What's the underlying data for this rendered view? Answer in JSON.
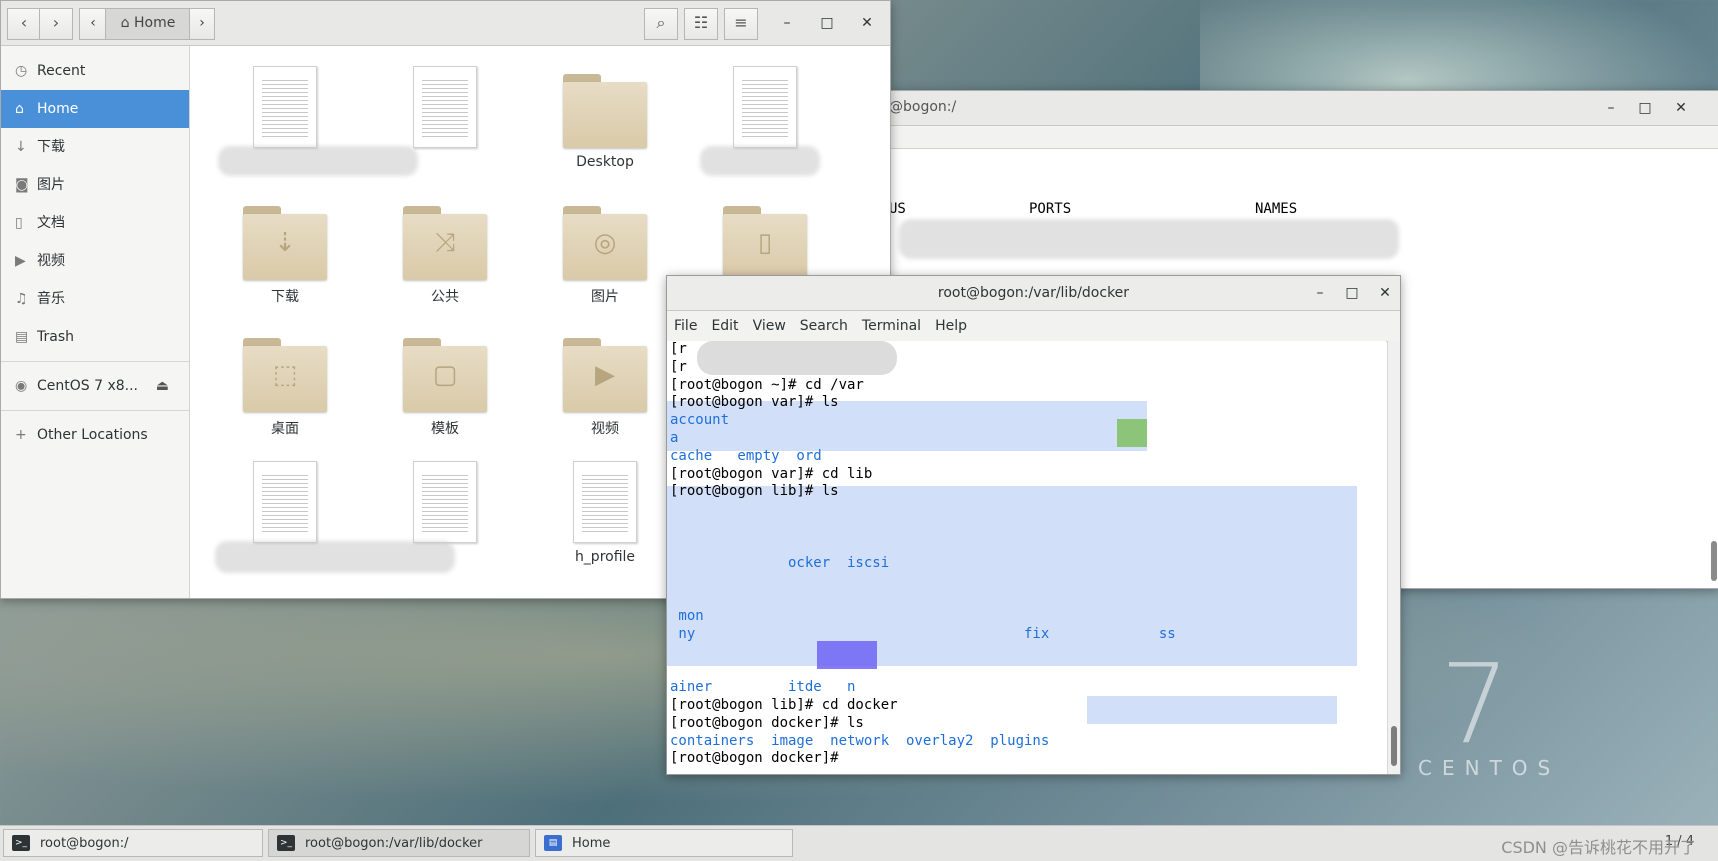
{
  "files_window": {
    "path_label": "Home",
    "sidebar": [
      {
        "icon": "clock-icon",
        "glyph": "◷",
        "label": "Recent"
      },
      {
        "icon": "home-icon",
        "glyph": "⌂",
        "label": "Home",
        "selected": true
      },
      {
        "icon": "download-icon",
        "glyph": "↓",
        "label": "下载"
      },
      {
        "icon": "camera-icon",
        "glyph": "◙",
        "label": "图片"
      },
      {
        "icon": "document-icon",
        "glyph": "▯",
        "label": "文档"
      },
      {
        "icon": "video-icon",
        "glyph": "▶",
        "label": "视频"
      },
      {
        "icon": "music-icon",
        "glyph": "♫",
        "label": "音乐"
      },
      {
        "icon": "trash-icon",
        "glyph": "🗑",
        "label": "Trash"
      },
      {
        "icon": "disc-icon",
        "glyph": "◉",
        "label": "CentOS 7 x8..."
      },
      {
        "icon": "plus-icon",
        "glyph": "+",
        "label": "Other Locations"
      }
    ],
    "items": {
      "desktop": "Desktop",
      "downloads": "下载",
      "public": "公共",
      "pictures": "图片",
      "desktop_cn": "桌面",
      "templates": "模板",
      "videos": "视频",
      "bash_profile": "h_profile"
    }
  },
  "background_terminal": {
    "title": "@bogon:/",
    "col_status": "US",
    "col_ports": "PORTS",
    "col_names": "NAMES"
  },
  "terminal": {
    "title": "root@bogon:/var/lib/docker",
    "menu": [
      "File",
      "Edit",
      "View",
      "Search",
      "Terminal",
      "Help"
    ],
    "lines": [
      {
        "text": "[r",
        "cls": ""
      },
      {
        "text": "[r",
        "cls": ""
      },
      {
        "text": "[root@bogon ~]# cd /var",
        "cls": ""
      },
      {
        "text": "[root@bogon var]# ls",
        "cls": ""
      },
      {
        "text": "account",
        "cls": "blue"
      },
      {
        "text": "a",
        "cls": "blue"
      },
      {
        "text": "cache   empty  ord",
        "cls": "blue"
      },
      {
        "text": "[root@bogon var]# cd lib",
        "cls": ""
      },
      {
        "text": "[root@bogon lib]# ls",
        "cls": ""
      },
      {
        "text": "",
        "cls": "blue"
      },
      {
        "text": "",
        "cls": "blue"
      },
      {
        "text": "",
        "cls": "blue"
      },
      {
        "text": "              ocker  iscsi",
        "cls": "blue"
      },
      {
        "text": "",
        "cls": "blue"
      },
      {
        "text": "",
        "cls": "blue"
      },
      {
        "text": " mon",
        "cls": "blue"
      },
      {
        "text": " ny                                       fix             ss",
        "cls": "blue"
      },
      {
        "text": "",
        "cls": "blue"
      },
      {
        "text": "",
        "cls": "blue"
      },
      {
        "text": "ainer         itde   n",
        "cls": "blue"
      },
      {
        "text": "[root@bogon lib]# cd docker",
        "cls": ""
      },
      {
        "text": "[root@bogon docker]# ls",
        "cls": ""
      },
      {
        "text": "containers  image  network  overlay2  plugins",
        "cls": "blue"
      },
      {
        "text": "[root@bogon docker]#",
        "cls": ""
      }
    ]
  },
  "taskbar": {
    "tasks": [
      "root@bogon:/",
      "root@bogon:/var/lib/docker",
      "Home"
    ],
    "pager": "1 / 4",
    "watermark": "CSDN @告诉桃花不用开了"
  },
  "desktop": {
    "logo_number": "7",
    "logo_word": "CENTOS"
  }
}
